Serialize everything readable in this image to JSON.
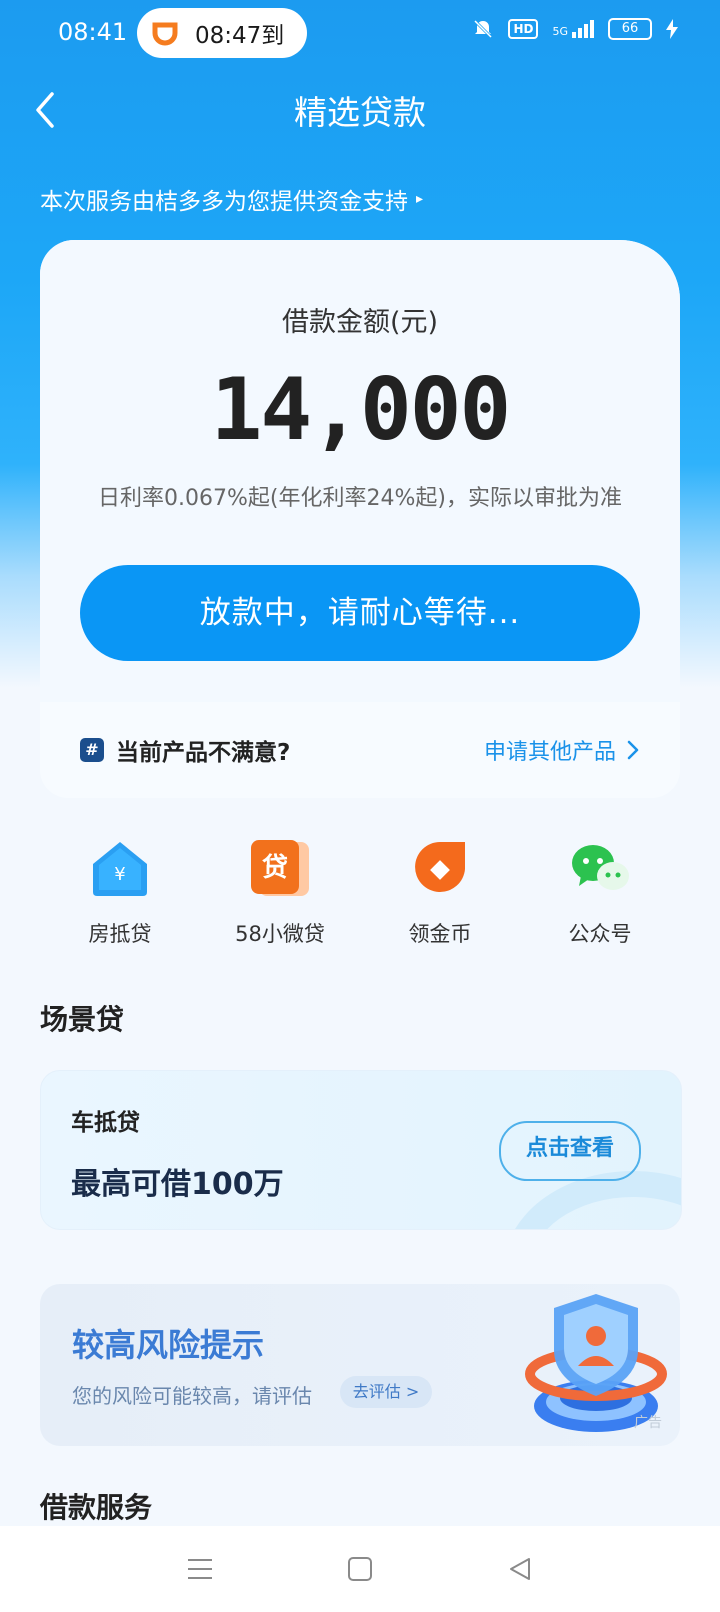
{
  "status_bar": {
    "time": "08:41",
    "notification": "08:47到",
    "hd": "HD",
    "network": "5G",
    "battery": "66"
  },
  "header": {
    "title": "精选贷款"
  },
  "provider_note": "本次服务由桔多多为您提供资金支持",
  "loan_card": {
    "amount_label": "借款金额(元)",
    "amount": "14,000",
    "rate_text": "日利率0.067%起(年化利率24%起)，实际以审批为准",
    "status_button": "放款中，请耐心等待...",
    "dissatisfied_text": "当前产品不满意?",
    "apply_other": "申请其他产品",
    "hash_icon": "#"
  },
  "quick_links": [
    {
      "label": "房抵贷",
      "icon": "house-loan-icon"
    },
    {
      "label": "58小微贷",
      "icon": "loan-badge-icon"
    },
    {
      "label": "领金币",
      "icon": "coin-icon"
    },
    {
      "label": "公众号",
      "icon": "wechat-icon"
    }
  ],
  "scene_loan": {
    "section_title": "场景贷",
    "card_title": "车抵贷",
    "card_sub": "最高可借100万",
    "button": "点击查看"
  },
  "risk": {
    "title": "较高风险提示",
    "subtitle": "您的风险可能较高，请评估",
    "button": "去评估 >",
    "ad_label": "广告"
  },
  "loan_service": {
    "section_title": "借款服务"
  },
  "colors": {
    "primary": "#0a96f5",
    "header_bg": "#1c9bf0",
    "link": "#1a92e9"
  }
}
